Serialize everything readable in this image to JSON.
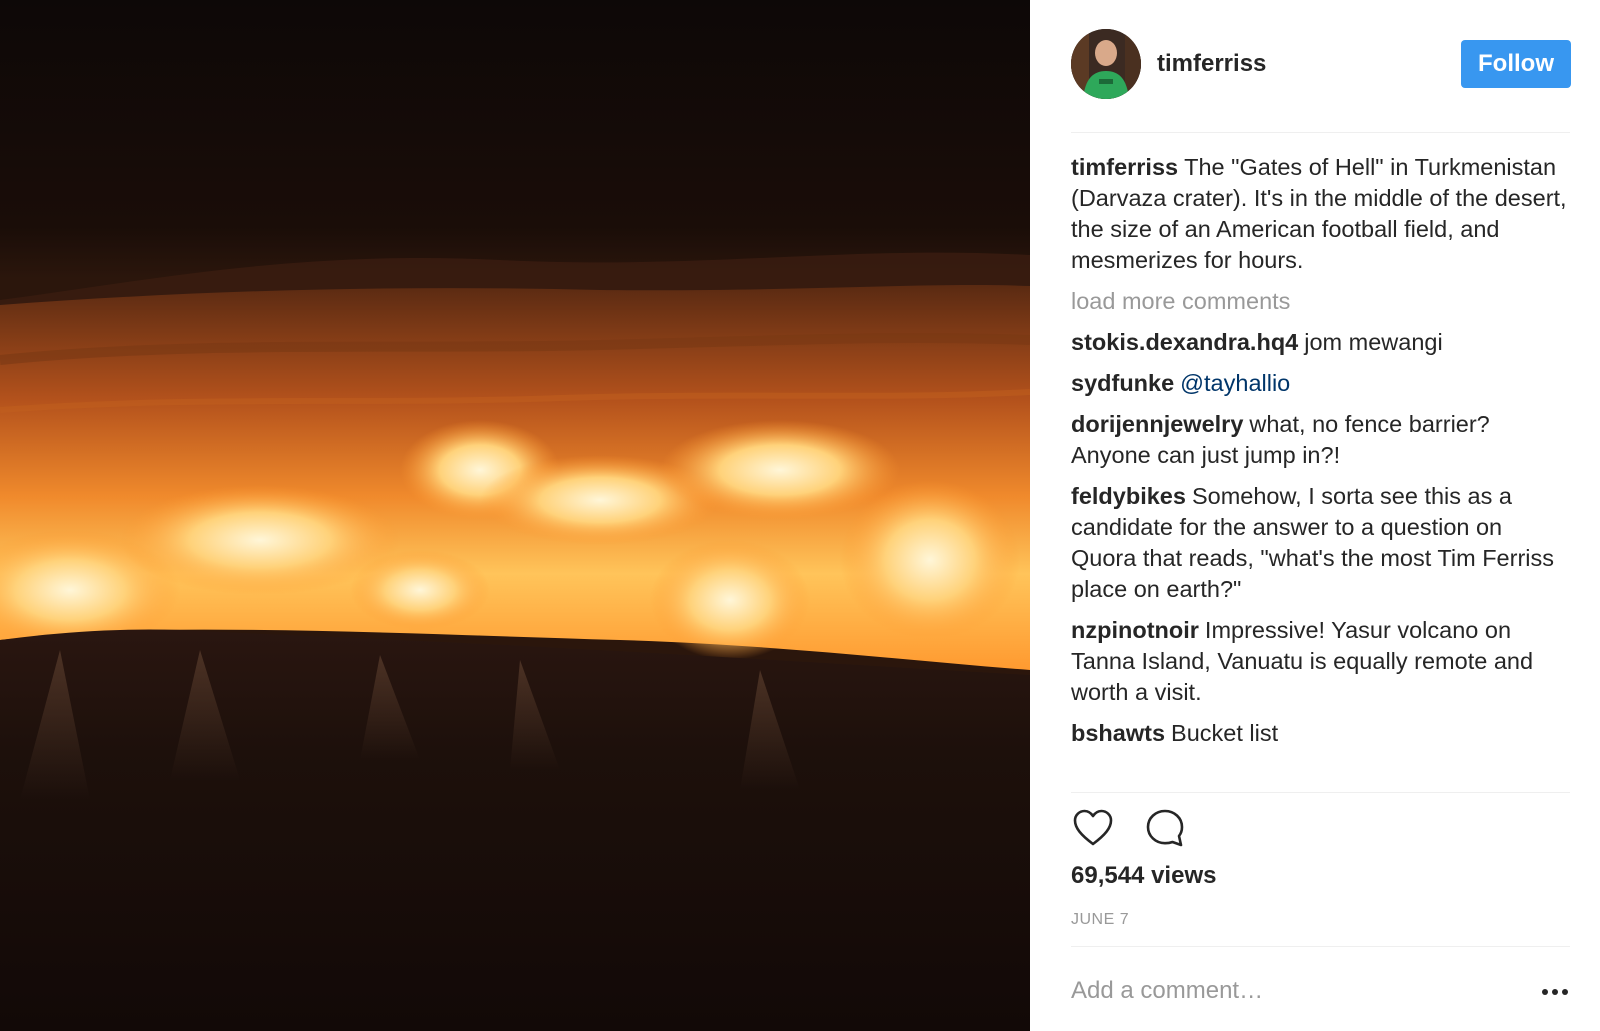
{
  "post": {
    "author": "timferriss",
    "follow_label": "Follow",
    "caption": {
      "author": "timferriss",
      "text": "The \"Gates of Hell\" in Turkmenistan (Darvaza crater). It's in the middle of the desert, the size of an American football field, and mesmerizes for hours."
    },
    "load_more_label": "load more comments",
    "comments": [
      {
        "author": "stokis.dexandra.hq4",
        "text": "jom mewangi"
      },
      {
        "author": "sydfunke",
        "mention": "@tayhallio"
      },
      {
        "author": "dorijennjewelry",
        "text": "what, no fence barrier? Anyone can just jump in?!"
      },
      {
        "author": "feldybikes",
        "text": "Somehow, I sorta see this as a candidate for the answer to a question on Quora that reads, \"what's the most Tim Ferriss place on earth?\""
      },
      {
        "author": "nzpinotnoir",
        "text": "Impressive! Yasur volcano on Tanna Island, Vanuatu is equally remote and worth a visit."
      },
      {
        "author": "bshawts",
        "text": "Bucket list"
      }
    ],
    "views": "69,544 views",
    "date": "JUNE 7",
    "add_comment_placeholder": "Add a comment…",
    "colors": {
      "follow_button": "#3897f0",
      "mention": "#003569",
      "muted": "#999999"
    },
    "icons": [
      "heart-icon",
      "comment-icon",
      "more-options-icon"
    ]
  }
}
